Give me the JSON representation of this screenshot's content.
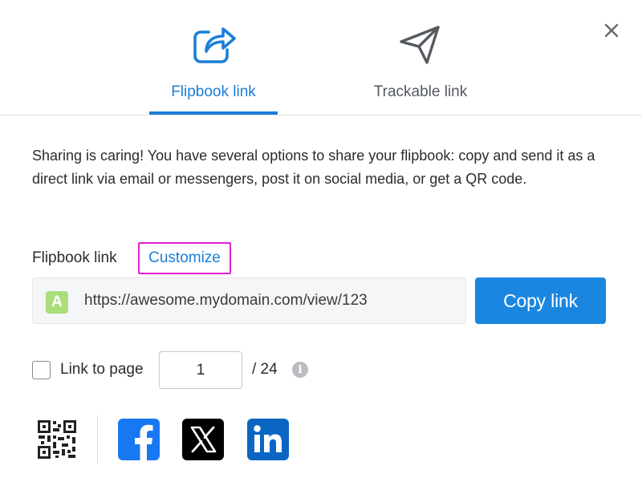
{
  "tabs": [
    {
      "label": "Flipbook link",
      "icon": "share-arrow-icon",
      "active": true
    },
    {
      "label": "Trackable link",
      "icon": "paper-plane-icon",
      "active": false
    }
  ],
  "description": "Sharing is caring! You have several options to share your flipbook: copy and send it as a direct link via email or messengers, post it on social media, or get a QR code.",
  "link_section": {
    "label": "Flipbook link",
    "customize_label": "Customize",
    "favicon_letter": "A",
    "url": "https://awesome.mydomain.com/view/123",
    "copy_label": "Copy link"
  },
  "page_link": {
    "label": "Link to page",
    "value": "1",
    "total": "/ 24",
    "info_glyph": "i",
    "checked": false
  },
  "share": {
    "icons": [
      "qr-code-icon",
      "facebook-icon",
      "x-icon",
      "linkedin-icon"
    ]
  },
  "colors": {
    "accent": "#1a7fd8",
    "highlight": "#e020d0",
    "favicon": "#a9de7b",
    "facebook": "#1877f2",
    "x": "#000000",
    "linkedin": "#0a66c2"
  }
}
